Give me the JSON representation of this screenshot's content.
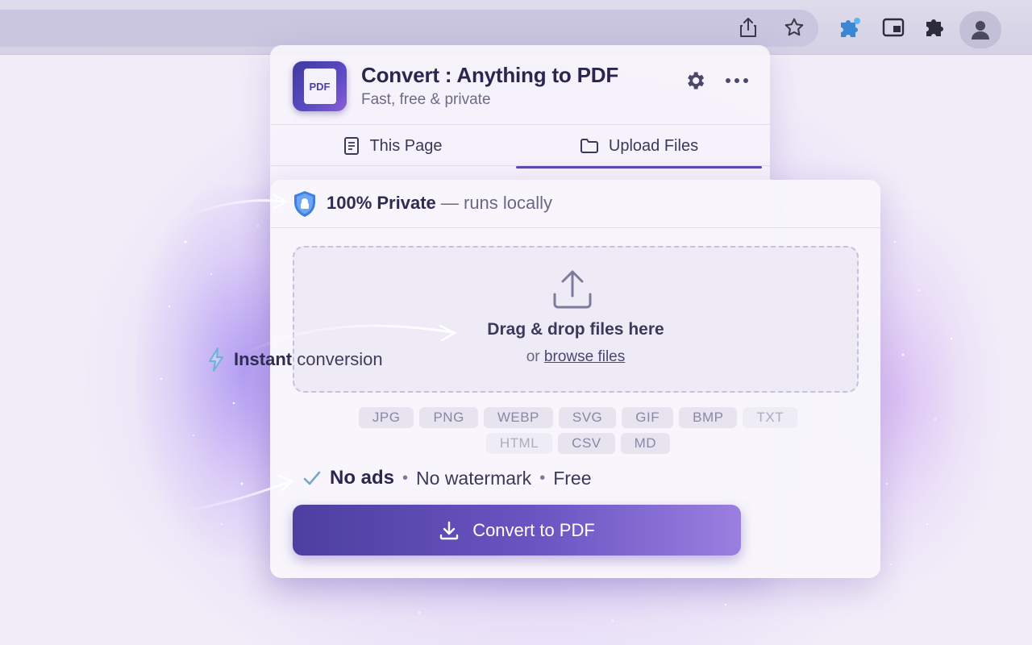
{
  "toolbar": {
    "icons": [
      "share-icon",
      "star-icon",
      "extension-color-icon",
      "window-icon",
      "puzzle-icon",
      "profile-icon"
    ]
  },
  "header": {
    "title": "Convert : Anything to PDF",
    "subtitle": "Fast, free & private",
    "app_icon_label": "PDF"
  },
  "tabs": [
    {
      "label": "This Page",
      "active": false
    },
    {
      "label": "Upload Files",
      "active": true
    }
  ],
  "private": {
    "strong": "100% Private",
    "rest": " — runs locally"
  },
  "dropzone": {
    "title": "Drag & drop files here",
    "or_text": "or ",
    "browse_link": "browse files"
  },
  "formats": [
    "JPG",
    "PNG",
    "WEBP",
    "SVG",
    "GIF",
    "BMP",
    "TXT",
    "HTML",
    "CSV",
    "MD"
  ],
  "features": {
    "strong": "No ads",
    "item2": "No watermark",
    "item3": "Free",
    "separator": "•"
  },
  "convert_button": {
    "label": "Convert to PDF"
  },
  "callout": {
    "strong": "Instant",
    "rest": " conversion"
  },
  "colors": {
    "accent": "#5a4bb0",
    "button_start": "#4d3fa0",
    "button_end": "#9b7fe0",
    "shield": "#3f7fe0"
  }
}
